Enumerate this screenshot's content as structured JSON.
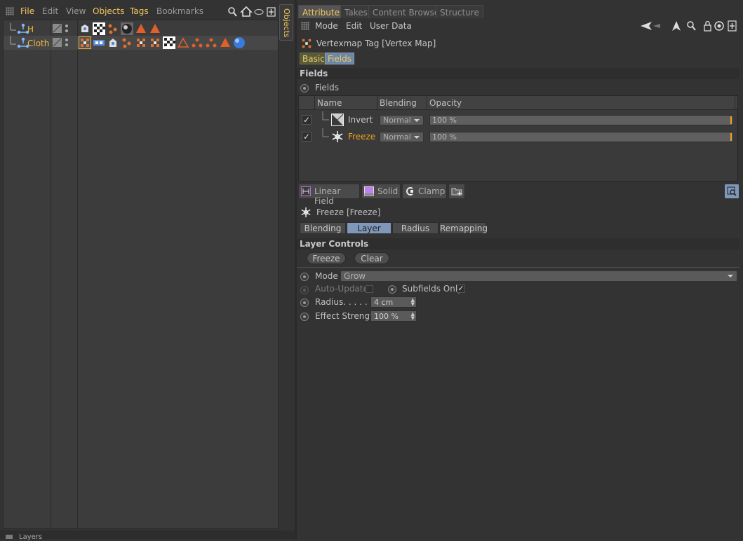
{
  "object_manager": {
    "menu": [
      "File",
      "Edit",
      "View",
      "Objects",
      "Tags",
      "Bookmarks"
    ],
    "objects": [
      {
        "name": "H"
      },
      {
        "name": "Cloth"
      }
    ],
    "side_tab": "Objects",
    "layers_label": "Layers"
  },
  "attributes": {
    "tabs": [
      "Attributes",
      "Takes",
      "Content Browser",
      "Structure"
    ],
    "menu": [
      "Mode",
      "Edit",
      "User Data"
    ],
    "tag_title": "Vertexmap Tag [Vertex Map]",
    "basic_tab": "Basic",
    "fields_tab": "Fields",
    "fields_section": "Fields",
    "fields_param": "Fields",
    "list_headers": {
      "name": "Name",
      "blending": "Blending",
      "opacity": "Opacity"
    },
    "field_rows": [
      {
        "name": "Invert",
        "check": "✓",
        "blending": "Normal",
        "opacity": "100 %"
      },
      {
        "name": "Freeze",
        "check": "✓",
        "blending": "Normal",
        "opacity": "100 %"
      }
    ],
    "toolbar": {
      "linear": "Linear Field",
      "solid": "Solid",
      "clamp": "Clamp"
    },
    "sub_title": "Freeze [Freeze]",
    "sub_tabs": [
      "Blending",
      "Layer",
      "Radius",
      "Remapping"
    ],
    "layer_controls": "Layer Controls",
    "freeze_btn": "Freeze",
    "clear_btn": "Clear",
    "mode_label": "Mode",
    "mode_value": "Grow",
    "auto_update": "Auto-Update",
    "subfields_only": "Subfields Only",
    "subfields_check": "✓",
    "radius_label": "Radius. . . . . . .",
    "radius_value": "4 cm",
    "strength_label": "Effect Strength",
    "strength_value": "100 %"
  },
  "colors": {
    "accent": "#f6c85c",
    "bg": "#333333",
    "tag_orange": "#e0602a",
    "tab_active_blue": "#7f98ba"
  }
}
